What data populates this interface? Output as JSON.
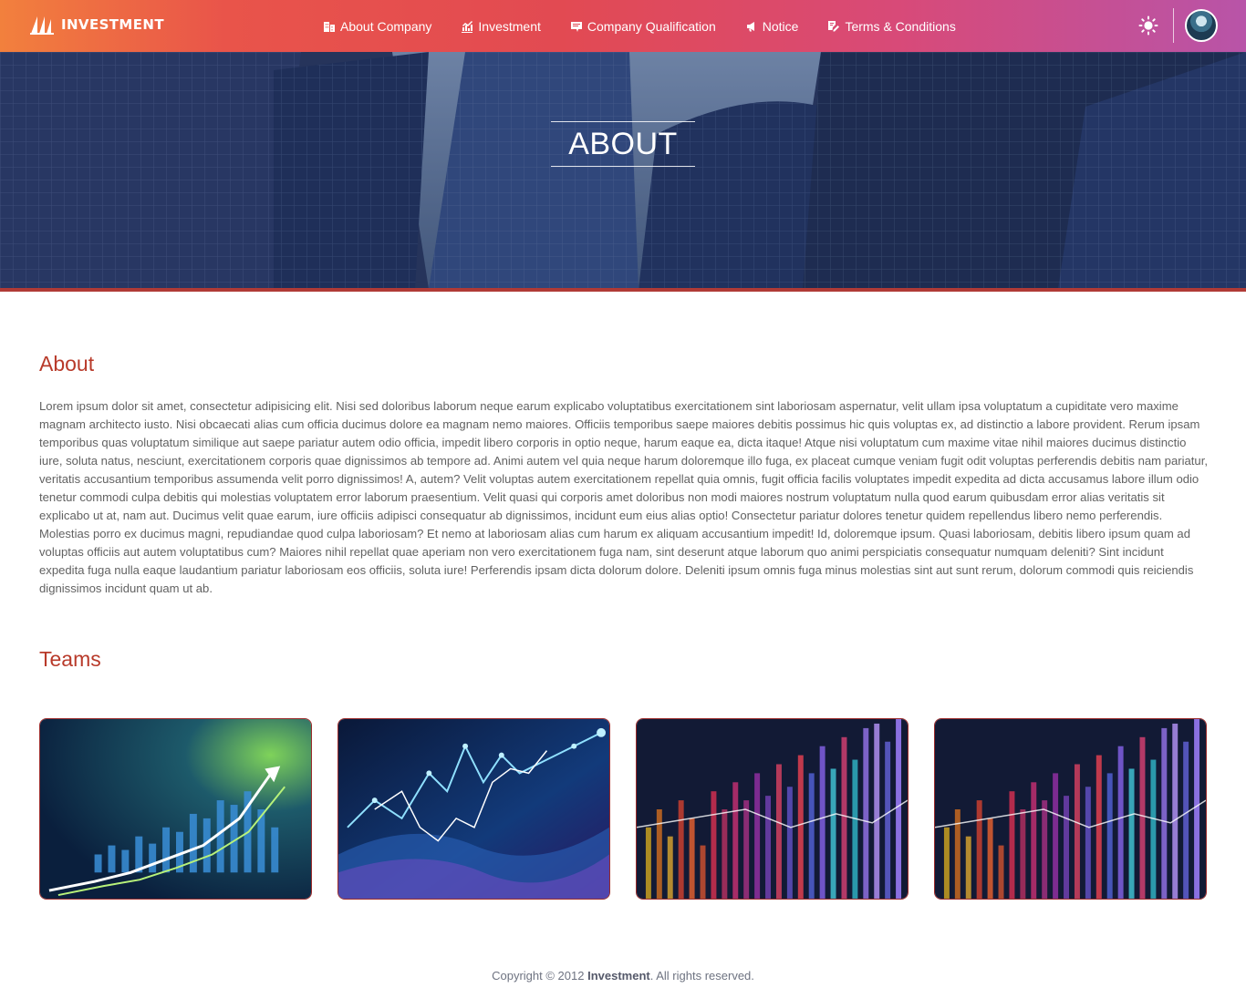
{
  "header": {
    "brand": "INVESTMENT",
    "nav": [
      {
        "label": "About Company",
        "icon": "building-icon"
      },
      {
        "label": "Investment",
        "icon": "chart-icon"
      },
      {
        "label": "Company Qualification",
        "icon": "certificate-icon"
      },
      {
        "label": "Notice",
        "icon": "megaphone-icon"
      },
      {
        "label": "Terms & Conditions",
        "icon": "edit-document-icon"
      }
    ],
    "theme_icon": "sun-icon",
    "avatar_icon": "user-avatar"
  },
  "hero": {
    "title": "ABOUT"
  },
  "about": {
    "heading": "About",
    "text": "Lorem ipsum dolor sit amet, consectetur adipisicing elit. Nisi sed doloribus laborum neque earum explicabo voluptatibus exercitationem sint laboriosam aspernatur, velit ullam ipsa voluptatum a cupiditate vero maxime magnam architecto iusto. Nisi obcaecati alias cum officia ducimus dolore ea magnam nemo maiores. Officiis temporibus saepe maiores debitis possimus hic quis voluptas ex, ad distinctio a labore provident. Rerum ipsam temporibus quas voluptatum similique aut saepe pariatur autem odio officia, impedit libero corporis in optio neque, harum eaque ea, dicta itaque! Atque nisi voluptatum cum maxime vitae nihil maiores ducimus distinctio iure, soluta natus, nesciunt, exercitationem corporis quae dignissimos ab tempore ad. Animi autem vel quia neque harum doloremque illo fuga, ex placeat cumque veniam fugit odit voluptas perferendis debitis nam pariatur, veritatis accusantium temporibus assumenda velit porro dignissimos! A, autem? Velit voluptas autem exercitationem repellat quia omnis, fugit officia facilis voluptates impedit expedita ad dicta accusamus labore illum odio tenetur commodi culpa debitis qui molestias voluptatem error laborum praesentium. Velit quasi qui corporis amet doloribus non modi maiores nostrum voluptatum nulla quod earum quibusdam error alias veritatis sit explicabo ut at, nam aut. Ducimus velit quae earum, iure officiis adipisci consequatur ab dignissimos, incidunt eum eius alias optio! Consectetur pariatur dolores tenetur quidem repellendus libero nemo perferendis. Molestias porro ex ducimus magni, repudiandae quod culpa laboriosam? Et nemo at laboriosam alias cum harum ex aliquam accusantium impedit! Id, doloremque ipsum. Quasi laboriosam, debitis libero ipsum quam ad voluptas officiis aut autem voluptatibus cum? Maiores nihil repellat quae aperiam non vero exercitationem fuga nam, sint deserunt atque laborum quo animi perspiciatis consequatur numquam deleniti? Sint incidunt expedita fuga nulla eaque laudantium pariatur laboriosam eos officiis, soluta iure! Perferendis ipsam dicta dolorum dolore. Deleniti ipsum omnis fuga minus molestias sint aut sunt rerum, dolorum commodi quis reiciendis dignissimos incidunt quam ut ab."
  },
  "teams": {
    "heading": "Teams",
    "cards": [
      {
        "image": "growth-chart-image"
      },
      {
        "image": "stock-line-chart-image"
      },
      {
        "image": "candlestick-chart-image"
      },
      {
        "image": "candlestick-chart-image"
      }
    ]
  },
  "footer": {
    "prefix": "Copyright © 2012 ",
    "brand": "Investment",
    "suffix": ". All rights reserved."
  },
  "colors": {
    "accent": "#b83a2a",
    "hero_bar": "#b03a36",
    "nav_gradient_start": "#f2803d",
    "nav_gradient_end": "#b854a8"
  }
}
